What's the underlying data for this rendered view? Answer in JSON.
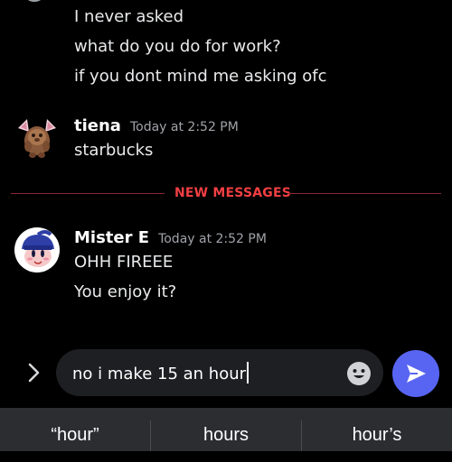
{
  "messages_prev": [
    "I never asked",
    "what do you do for work?",
    "if you dont mind me asking ofc"
  ],
  "tiena": {
    "username": "tiena",
    "timestamp": "Today at 2:52 PM",
    "lines": [
      "starbucks"
    ]
  },
  "divider": {
    "label": "NEW MESSAGES"
  },
  "mistere": {
    "username": "Mister E",
    "timestamp": "Today at 2:52 PM",
    "lines": [
      "OHH FIREEE",
      "You enjoy it?"
    ]
  },
  "composer": {
    "value": "no i make 15 an hour"
  },
  "icons": {
    "expand": "chevron-right-icon",
    "emoji": "emoji-smile-icon",
    "send": "send-arrow-icon"
  },
  "suggestions": [
    "“hour”",
    "hours",
    "hour’s"
  ],
  "colors": {
    "background": "#000000",
    "accent": "#5865f2",
    "new_messages": "#f23f43",
    "input_bg": "#1e1f22",
    "keyboard_bar": "#2b2d31"
  }
}
